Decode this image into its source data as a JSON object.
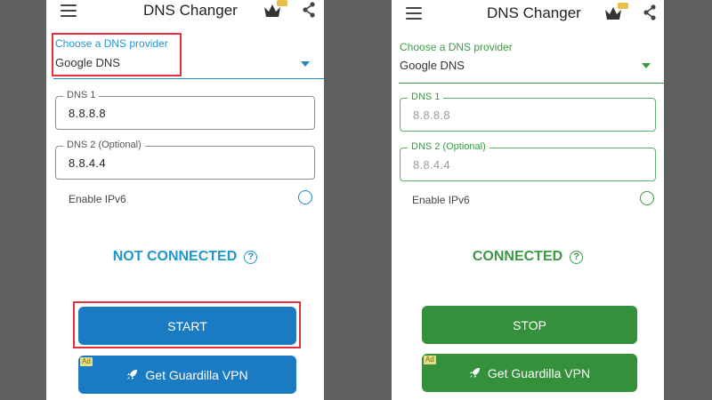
{
  "screens": [
    {
      "app_title": "DNS Changer",
      "provider_label": "Choose a DNS provider",
      "provider_value": "Google DNS",
      "dns1_label": "DNS 1",
      "dns1_value": "8.8.8.8",
      "dns2_label": "DNS 2 (Optional)",
      "dns2_value": "8.8.4.4",
      "ipv6_label": "Enable IPv6",
      "status": "NOT CONNECTED",
      "help_glyph": "?",
      "main_button": "START",
      "vpn_button": "Get Guardilla VPN",
      "ad_badge": "Ad"
    },
    {
      "app_title": "DNS Changer",
      "provider_label": "Choose a DNS provider",
      "provider_value": "Google DNS",
      "dns1_label": "DNS 1",
      "dns1_value": "8.8.8.8",
      "dns2_label": "DNS 2 (Optional)",
      "dns2_value": "8.8.4.4",
      "ipv6_label": "Enable IPv6",
      "status": "CONNECTED",
      "help_glyph": "?",
      "main_button": "STOP",
      "vpn_button": "Get Guardilla VPN",
      "ad_badge": "Ad"
    }
  ],
  "colors": {
    "disconnected_blue": "#1f96d1",
    "connected_green": "#3a9a44",
    "highlight_red": "#e5303a"
  }
}
